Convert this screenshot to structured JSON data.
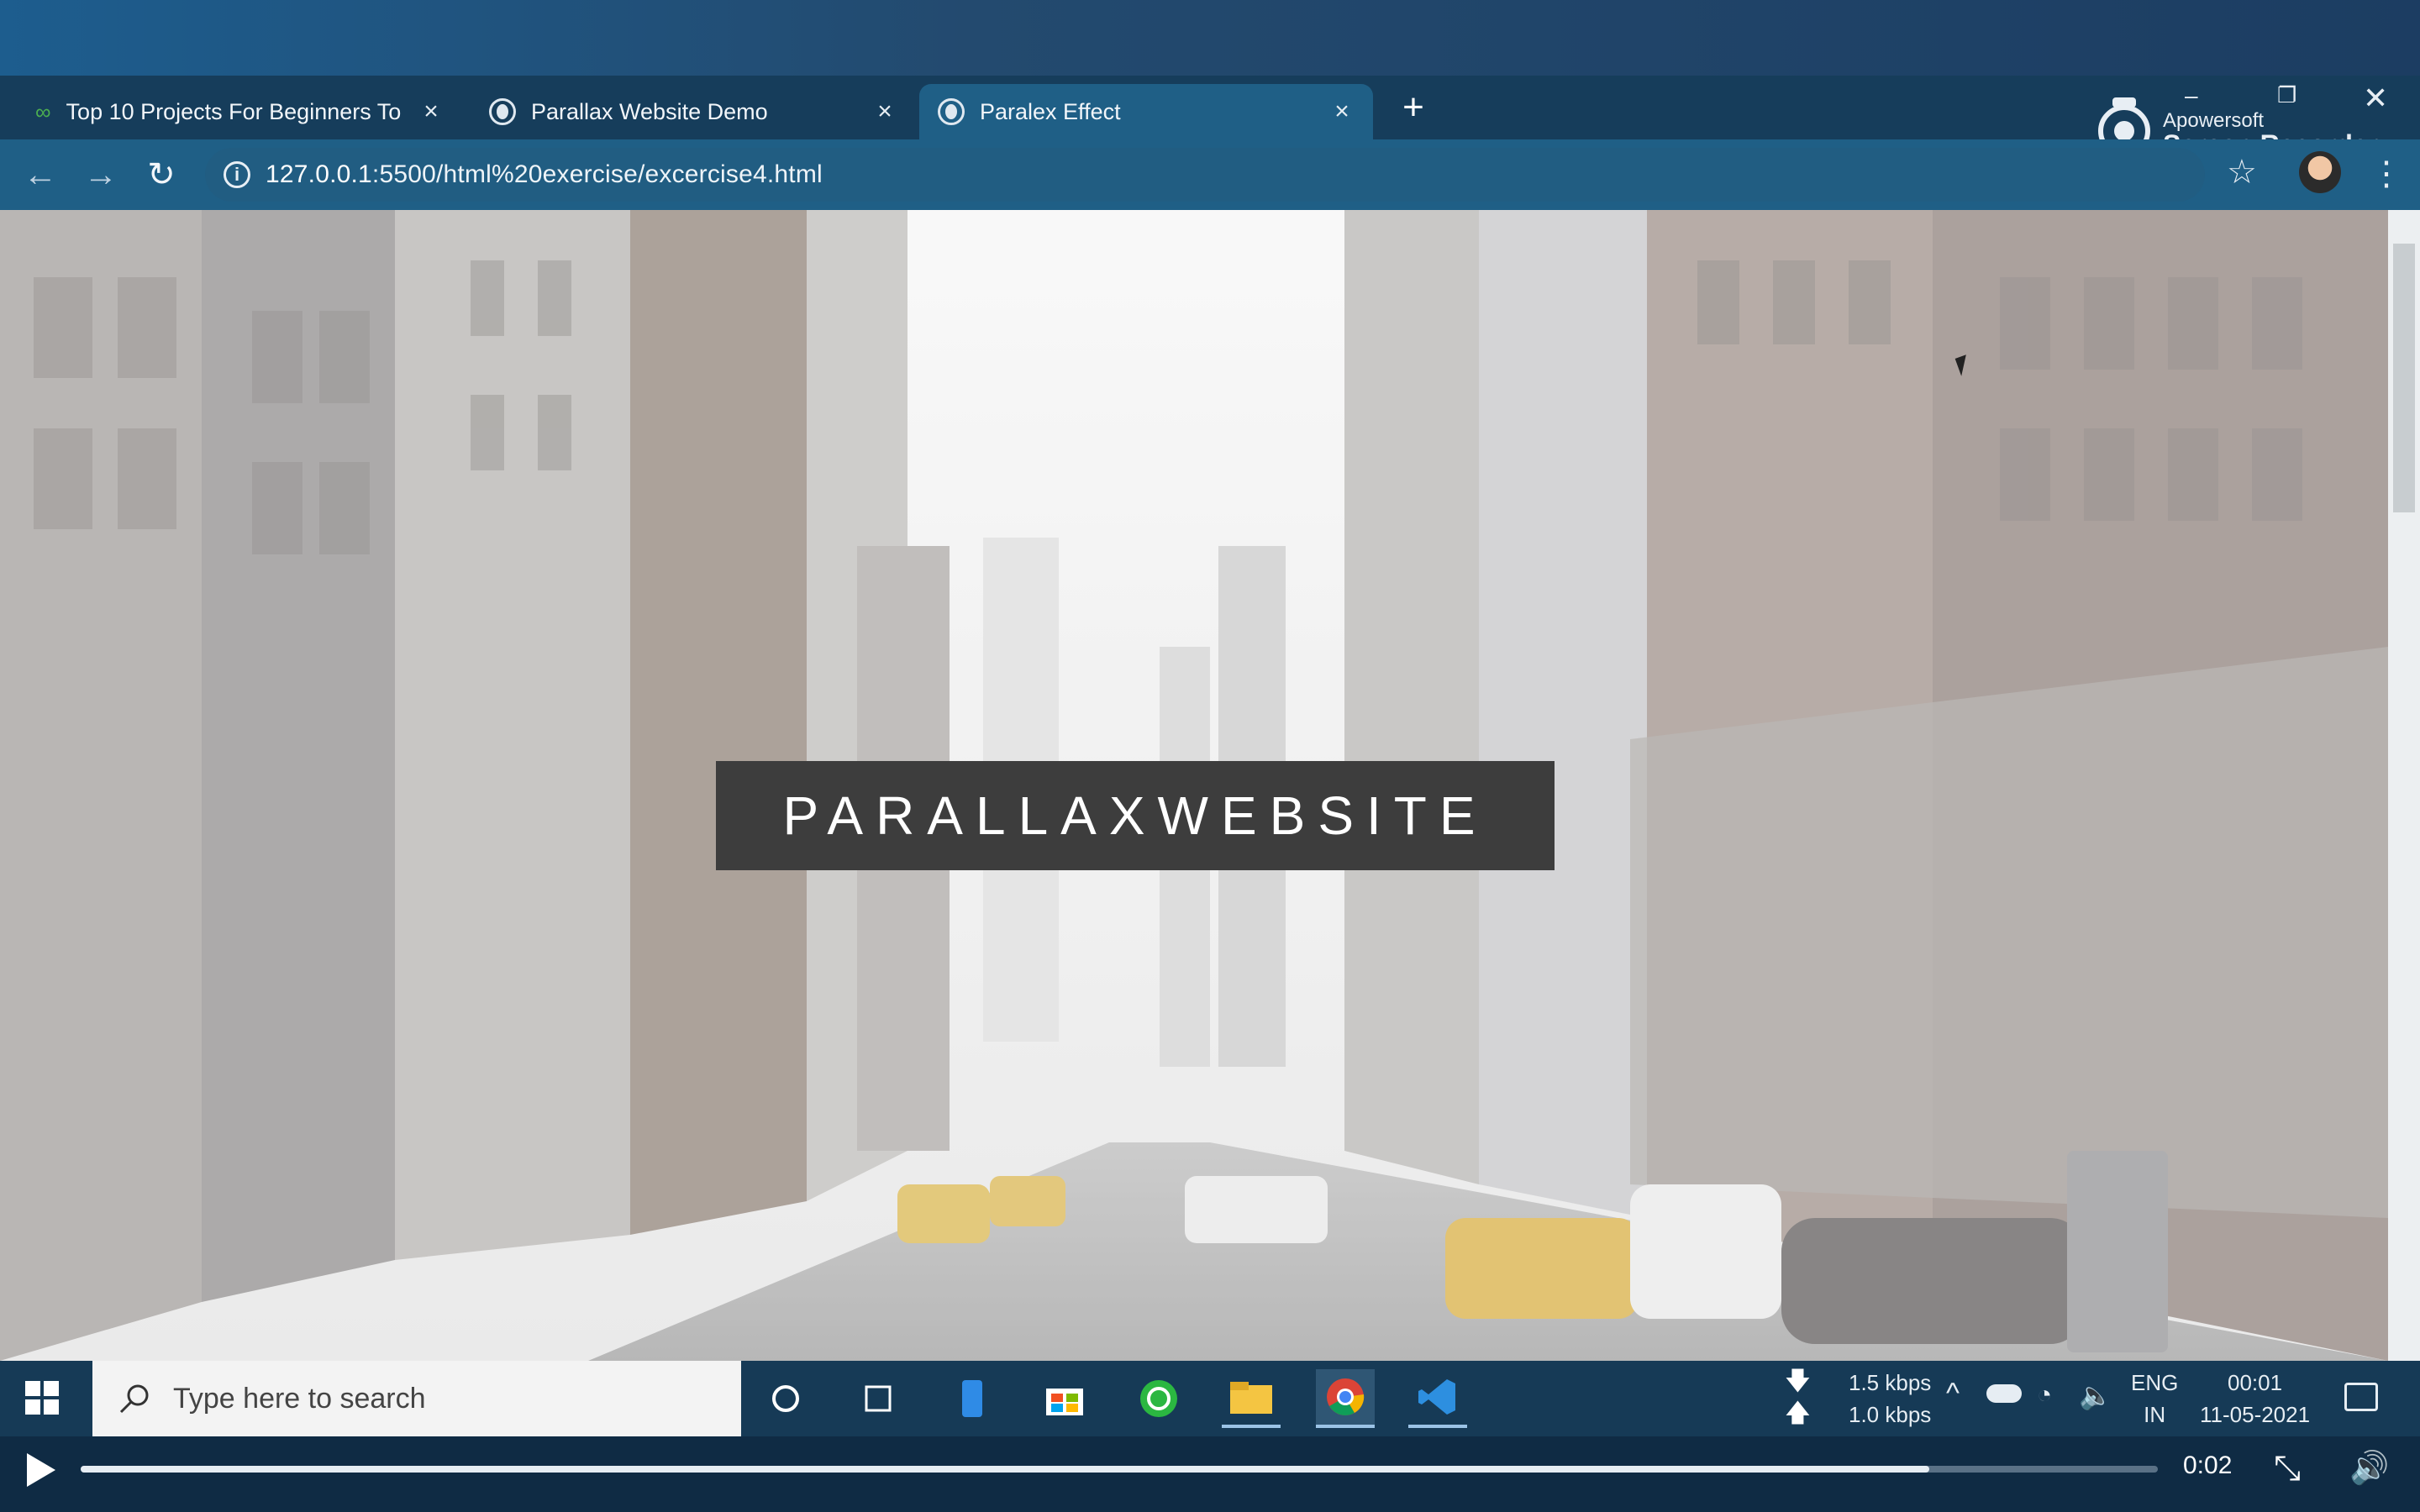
{
  "browser": {
    "tabs": [
      {
        "title": "Top 10 Projects For Beginners To",
        "close": "×",
        "icon": "game-icon"
      },
      {
        "title": "Parallax Website Demo",
        "close": "×",
        "icon": "globe-icon"
      },
      {
        "title": "Paralex Effect",
        "close": "×",
        "icon": "globe-icon",
        "active": true
      }
    ],
    "new_tab": "+",
    "url_host": "127.0.0.1",
    "url_rest": ":5500/html%20exercise/excercise4.html"
  },
  "recorder": {
    "brand": "Apowersoft",
    "name": "Screen Recorder"
  },
  "page": {
    "hero_title": "PARALLAXWEBSITE"
  },
  "taskbar": {
    "search_placeholder": "Type here to search",
    "net_down": "1.5 kbps",
    "net_up": "1.0 kbps",
    "lang": "ENG",
    "region": "IN",
    "time": "00:01",
    "date": "11-05-2021"
  },
  "player": {
    "elapsed": "0:02",
    "progress": 0.89
  },
  "colors": {
    "tab_active": "#1f5f86",
    "taskbar": "#163a56",
    "hero_box": "#3d3d3d"
  }
}
